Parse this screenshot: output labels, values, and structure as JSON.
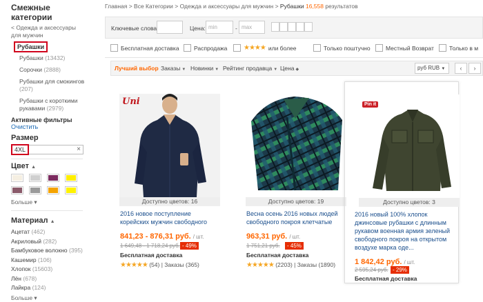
{
  "sidebar": {
    "title": "Смежные категории",
    "back_link": "< Одежда и аксессуары для мужчин",
    "current": "Рубашки",
    "subcats": [
      {
        "label": "Рубашки",
        "count": "(13432)"
      },
      {
        "label": "Сорочки",
        "count": "(2888)"
      },
      {
        "label": "Рубашки для смокингов",
        "count": "(207)"
      },
      {
        "label": "Рубашки с короткими рукавами",
        "count": "(2979)"
      }
    ],
    "active_filters": "Активные фильтры",
    "clear": "Очистить",
    "size_title": "Размер",
    "size_value": "4XL",
    "size_clear": "×",
    "color_title": "Цвет",
    "colors": [
      "#f5efe2",
      "#cfcfcf",
      "#7b2a5e",
      "#ffee00",
      "#8a5a6a",
      "#9a9a9a",
      "#f4a300",
      "#fff200"
    ],
    "more": "Больше ▾",
    "material_title": "Материал",
    "materials": [
      {
        "label": "Ацетат",
        "count": "(462)"
      },
      {
        "label": "Акриловый",
        "count": "(282)"
      },
      {
        "label": "Бамбуковое волокно",
        "count": "(395)"
      },
      {
        "label": "Кашемир",
        "count": "(106)"
      },
      {
        "label": "Хлопок",
        "count": "(15603)"
      },
      {
        "label": "Лён",
        "count": "(678)"
      },
      {
        "label": "Лайкра",
        "count": "(124)"
      }
    ],
    "more2": "Больше ▾"
  },
  "breadcrumb": {
    "path": "Главная > Все Категории > Одежда и аксессуары для мужчин > ",
    "current": "Рубашки",
    "count": "16,558",
    "suffix": " результатов"
  },
  "filters": {
    "keywords_label": "Ключевые слова:",
    "price_label": "Цена:",
    "min_placeholder": "min",
    "dash": "-",
    "max_placeholder": "max",
    "free_shipping": "Бесплатная доставка",
    "sale": "Распродажа",
    "rating_stars": "★★★★",
    "rating_more": "или более",
    "single_only": "Только поштучно",
    "local_return": "Местный Возврат",
    "only_in": "Только в м"
  },
  "sortbar": {
    "best": "Лучший выбор",
    "orders": "Заказы",
    "new": "Новинки",
    "seller_rating": "Рейтинг продавца",
    "price": "Цена",
    "currency": "руб RUB"
  },
  "products": [
    {
      "colors_available": "Доступно цветов: 16",
      "title": "2016 новое поступление корейских мужчин свободного",
      "price": "841,23 - 876,31 руб.",
      "unit": "/ шт.",
      "old_price": "1 649,48 - 1 718,24 руб.",
      "discount": "- 49%",
      "shipping": "Бесплатная доставка",
      "stars": "★★★★★",
      "reviews": "(54)",
      "orders": "Заказы (365)",
      "brand": "Uni"
    },
    {
      "colors_available": "Доступно цветов: 19",
      "title": "Весна осень 2016 новых людей свободного покроя клетчатые",
      "price": "963,31 руб.",
      "unit": "/ шт.",
      "old_price": "1 751,21 руб.",
      "discount": "- 45%",
      "shipping": "Бесплатная доставка",
      "stars": "★★★★★",
      "reviews": "(2203)",
      "orders": "Заказы (1890)"
    },
    {
      "colors_available": "Доступно цветов: 3",
      "title": "2016 новый 100% хлопок джинсовые рубашки с длинным рукавом военная армия зеленый свободного покроя на открытом воздухе марка оде...",
      "price": "1 842,42 руб.",
      "unit": "/ шт.",
      "old_price": "2 595,24 руб.",
      "discount": "- 29%",
      "shipping": "Бесплатная доставка",
      "pin": "Pin it"
    }
  ]
}
